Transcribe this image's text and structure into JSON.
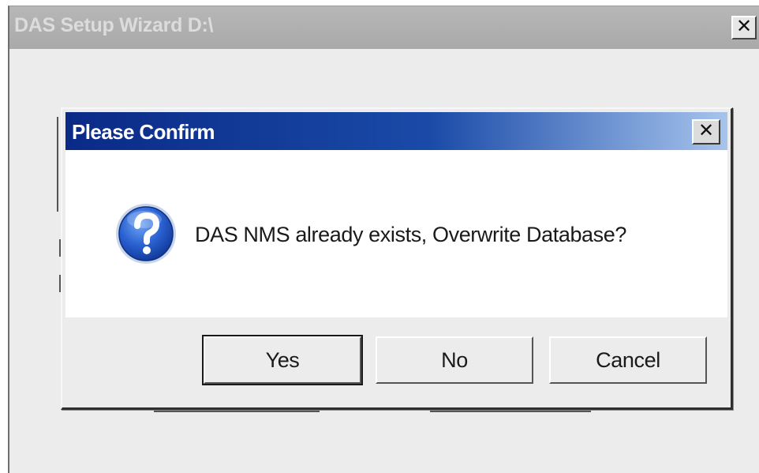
{
  "wizard": {
    "title": "DAS Setup Wizard D:\\",
    "close_glyph": "✕",
    "close_icon": "close-icon"
  },
  "dialog": {
    "title": "Please Confirm",
    "close_glyph": "✕",
    "close_icon": "close-icon",
    "icon": "question-icon",
    "message": "DAS NMS already exists, Overwrite Database?",
    "buttons": {
      "yes": "Yes",
      "no": "No",
      "cancel": "Cancel"
    },
    "default_button": "yes"
  },
  "colors": {
    "titlebar_active_start": "#0a2a86",
    "titlebar_active_end": "#a6c4ec",
    "titlebar_inactive": "#b0b0b0",
    "icon_blue": "#1f55c8"
  }
}
